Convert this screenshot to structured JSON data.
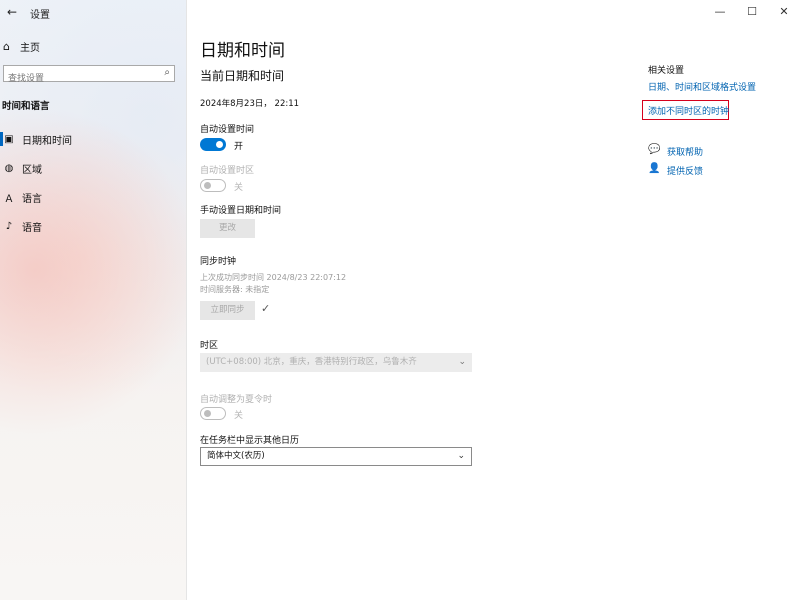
{
  "titlebar": {
    "back_icon": "arrow-left-icon",
    "title": "设置",
    "controls": {
      "minimize": "—",
      "maximize": "☐",
      "close": "✕"
    }
  },
  "sidebar": {
    "home_label": "主页",
    "search_placeholder": "查找设置",
    "section_label": "时间和语言",
    "items": [
      {
        "label": "日期和时间",
        "icon": "calendar-clock-icon",
        "active": true
      },
      {
        "label": "区域",
        "icon": "globe-icon"
      },
      {
        "label": "语言",
        "icon": "language-icon"
      },
      {
        "label": "语音",
        "icon": "microphone-icon"
      }
    ]
  },
  "main": {
    "page_title": "日期和时间",
    "sub_title": "当前日期和时间",
    "current_datetime": "2024年8月23日， 22:11",
    "auto_time": {
      "label": "自动设置时间",
      "state": "开",
      "on": true
    },
    "auto_timezone": {
      "label": "自动设置时区",
      "state": "关",
      "on": false,
      "disabled": true
    },
    "manual": {
      "label": "手动设置日期和时间",
      "button": "更改"
    },
    "sync": {
      "title": "同步时钟",
      "last_sync": "上次成功同步时间 2024/8/23 22:07:12",
      "server": "时间服务器: 未指定",
      "button": "立即同步",
      "check": "✓"
    },
    "timezone": {
      "label": "时区",
      "value": "(UTC+08:00) 北京，重庆，香港特别行政区，乌鲁木齐"
    },
    "dst": {
      "label": "自动调整为夏令时",
      "state": "关",
      "on": false,
      "disabled": true
    },
    "calendar": {
      "label": "在任务栏中显示其他日历",
      "value": "简体中文(农历)"
    }
  },
  "related": {
    "title": "相关设置",
    "link1": "日期、时间和区域格式设置",
    "link2": "添加不同时区的时钟",
    "highlight_color": "#d6001c",
    "help": {
      "label": "获取帮助",
      "icon": "chat-help-icon"
    },
    "feedback": {
      "label": "提供反馈",
      "icon": "feedback-person-icon"
    }
  },
  "colors": {
    "accent": "#0078d4",
    "link": "#0063b1"
  }
}
